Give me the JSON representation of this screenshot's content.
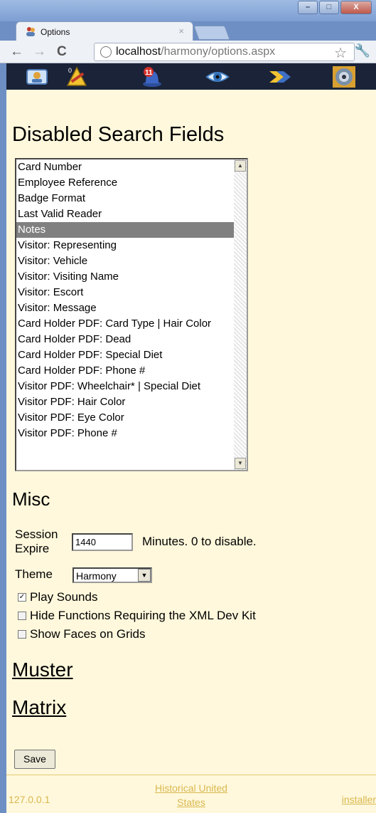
{
  "browser": {
    "tab_title": "Options",
    "tab_close": "×",
    "url_host": "localhost",
    "url_path": "/harmony/options.aspx",
    "window_buttons": {
      "minimize": "–",
      "maximize": "□",
      "close": "X"
    }
  },
  "icon_toolbar": {
    "items": [
      "id-card-icon",
      "badge-pencil-icon",
      "alarm-icon",
      "eye-icon",
      "forward-arrows-icon",
      "camera-lens-icon"
    ],
    "alarm_count": "11"
  },
  "search_fields": {
    "title": "Disabled Search Fields",
    "items": [
      "Card Number",
      "Employee Reference",
      "Badge Format",
      "Last Valid Reader",
      "Notes",
      "Visitor: Representing",
      "Visitor: Vehicle",
      "Visitor: Visiting Name",
      "Visitor: Escort",
      "Visitor: Message",
      "Card Holder PDF: Card Type | Hair Color",
      "Card Holder PDF: Dead",
      "Card Holder PDF: Special Diet",
      "Card Holder PDF: Phone #",
      "Visitor PDF: Wheelchair* | Special Diet",
      "Visitor PDF: Hair Color",
      "Visitor PDF: Eye Color",
      "Visitor PDF: Phone #"
    ],
    "selected_index": 4
  },
  "misc": {
    "title": "Misc",
    "session_label_1": "Session",
    "session_label_2": "Expire",
    "session_value": "1440",
    "session_hint": "Minutes. 0 to disable.",
    "theme_label": "Theme",
    "theme_value": "Harmony",
    "options": [
      {
        "label": "Play Sounds",
        "checked": true
      },
      {
        "label": "Hide Functions Requiring the XML Dev Kit",
        "checked": false
      },
      {
        "label": "Show Faces on Grids",
        "checked": false
      }
    ]
  },
  "links": {
    "muster": "Muster",
    "matrix": "Matrix"
  },
  "save_label": "Save",
  "footer": {
    "ip": "127.0.0.1",
    "region_1": "Historical United",
    "region_2": "States",
    "user": "installer"
  }
}
